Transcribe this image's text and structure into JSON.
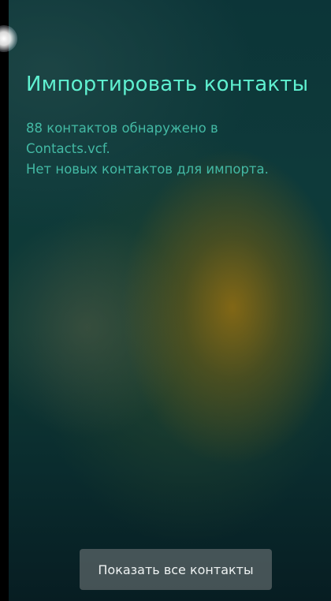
{
  "dialog": {
    "title": "Импортировать контакты",
    "message_lines": [
      "88 контактов обнаружено в",
      "Contacts.vcf.",
      "Нет новых контактов для импорта."
    ],
    "show_all_button": "Показать все контакты"
  },
  "colors": {
    "title": "#5ff0d0",
    "message": "#43b9a4",
    "button_text": "#eef2f2"
  }
}
